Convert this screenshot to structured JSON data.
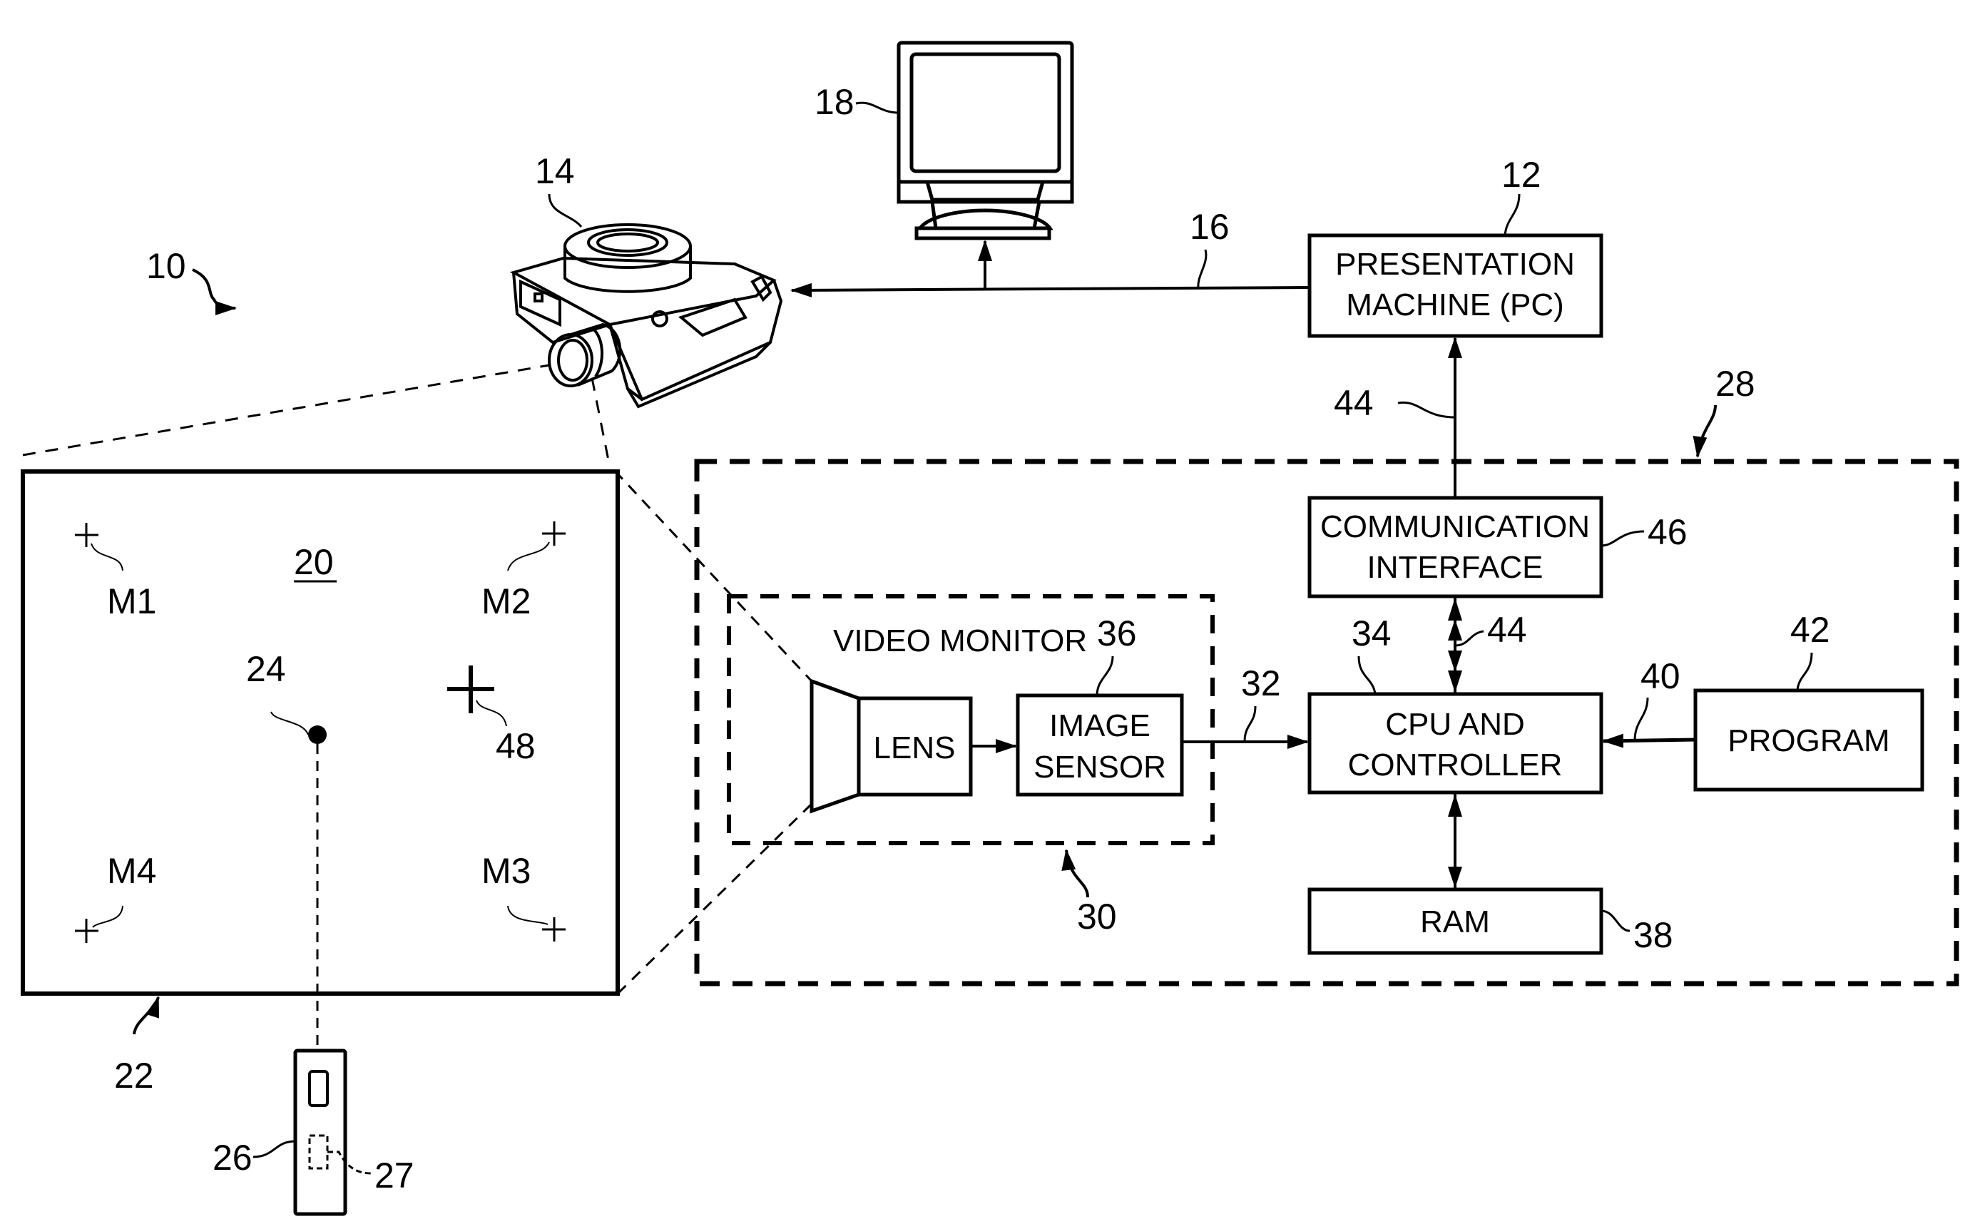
{
  "figure": {
    "system_ref": "10",
    "colors": {
      "ink": "#000000",
      "paper": "#ffffff"
    }
  },
  "components": {
    "presentation_machine": {
      "ref": "12",
      "lines": [
        "PRESENTATION",
        "MACHINE (PC)"
      ]
    },
    "projector": {
      "ref": "14"
    },
    "video_link": {
      "ref": "16"
    },
    "display_monitor": {
      "ref": "18"
    },
    "projected_image": {
      "ref": "20"
    },
    "screen": {
      "ref": "22"
    },
    "laser_spot": {
      "ref": "24"
    },
    "pointer_device": {
      "ref": "26"
    },
    "pointer_emitter": {
      "ref": "27"
    },
    "tracking_system": {
      "ref": "28"
    },
    "video_monitor": {
      "ref": "30",
      "title": "VIDEO MONITOR"
    },
    "lens": {
      "label": "LENS"
    },
    "image_sensor": {
      "ref": "36",
      "lines": [
        "IMAGE",
        "SENSOR"
      ]
    },
    "sensor_link": {
      "ref": "32"
    },
    "cpu_controller": {
      "ref": "34",
      "lines": [
        "CPU AND",
        "CONTROLLER"
      ]
    },
    "ram": {
      "ref": "38",
      "label": "RAM"
    },
    "program_link": {
      "ref": "40"
    },
    "program": {
      "ref": "42",
      "label": "PROGRAM"
    },
    "comm_link_upper": {
      "ref": "44"
    },
    "comm_link_lower": {
      "ref": "44"
    },
    "comm_interface": {
      "ref": "46",
      "lines": [
        "COMMUNICATION",
        "INTERFACE"
      ]
    },
    "cursor_marker": {
      "ref": "48"
    },
    "calibration_marks": [
      {
        "label": "M1"
      },
      {
        "label": "M2"
      },
      {
        "label": "M3"
      },
      {
        "label": "M4"
      }
    ]
  }
}
